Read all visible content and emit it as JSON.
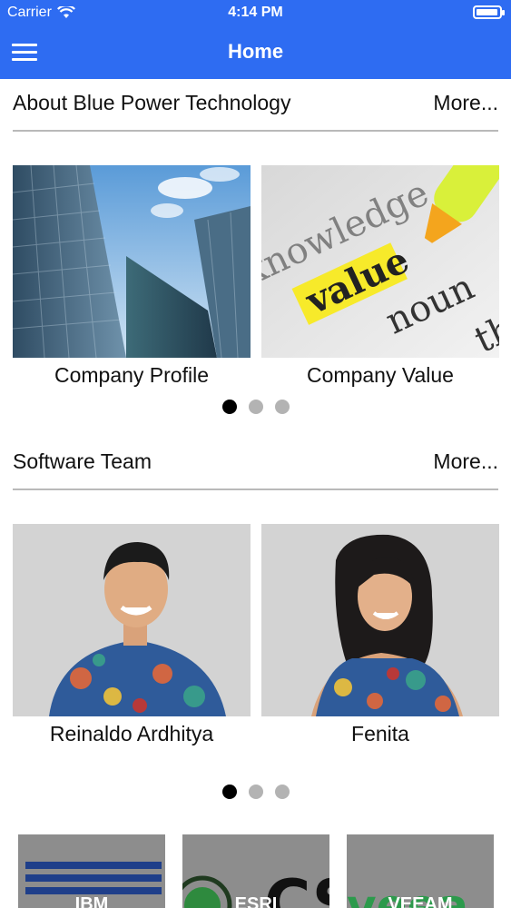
{
  "status_bar": {
    "carrier": "Carrier",
    "time": "4:14 PM",
    "battery_level": 0.95
  },
  "nav": {
    "title": "Home"
  },
  "about": {
    "title": "About Blue Power Technology",
    "more": "More...",
    "cards": [
      {
        "label": "Company Profile",
        "image": "glass-skyscrapers-photo"
      },
      {
        "label": "Company Value",
        "image": "dictionary-value-highlighted-photo"
      }
    ],
    "page_count": 3,
    "active_page": 1
  },
  "team": {
    "title": "Software Team",
    "more": "More...",
    "cards": [
      {
        "label": "Reinaldo Ardhitya",
        "image": "man-batik-shirt-portrait"
      },
      {
        "label": "Fenita",
        "image": "woman-batik-dress-portrait"
      }
    ],
    "page_count": 3,
    "active_page": 1
  },
  "partners": [
    {
      "name": "IBM"
    },
    {
      "name": "ESRI"
    },
    {
      "name": "VEEAM"
    }
  ],
  "colors": {
    "primary": "#2e6cf2",
    "dot_active": "#000000",
    "dot_inactive": "#b3b3b3",
    "divider": "#b9b9b9"
  }
}
